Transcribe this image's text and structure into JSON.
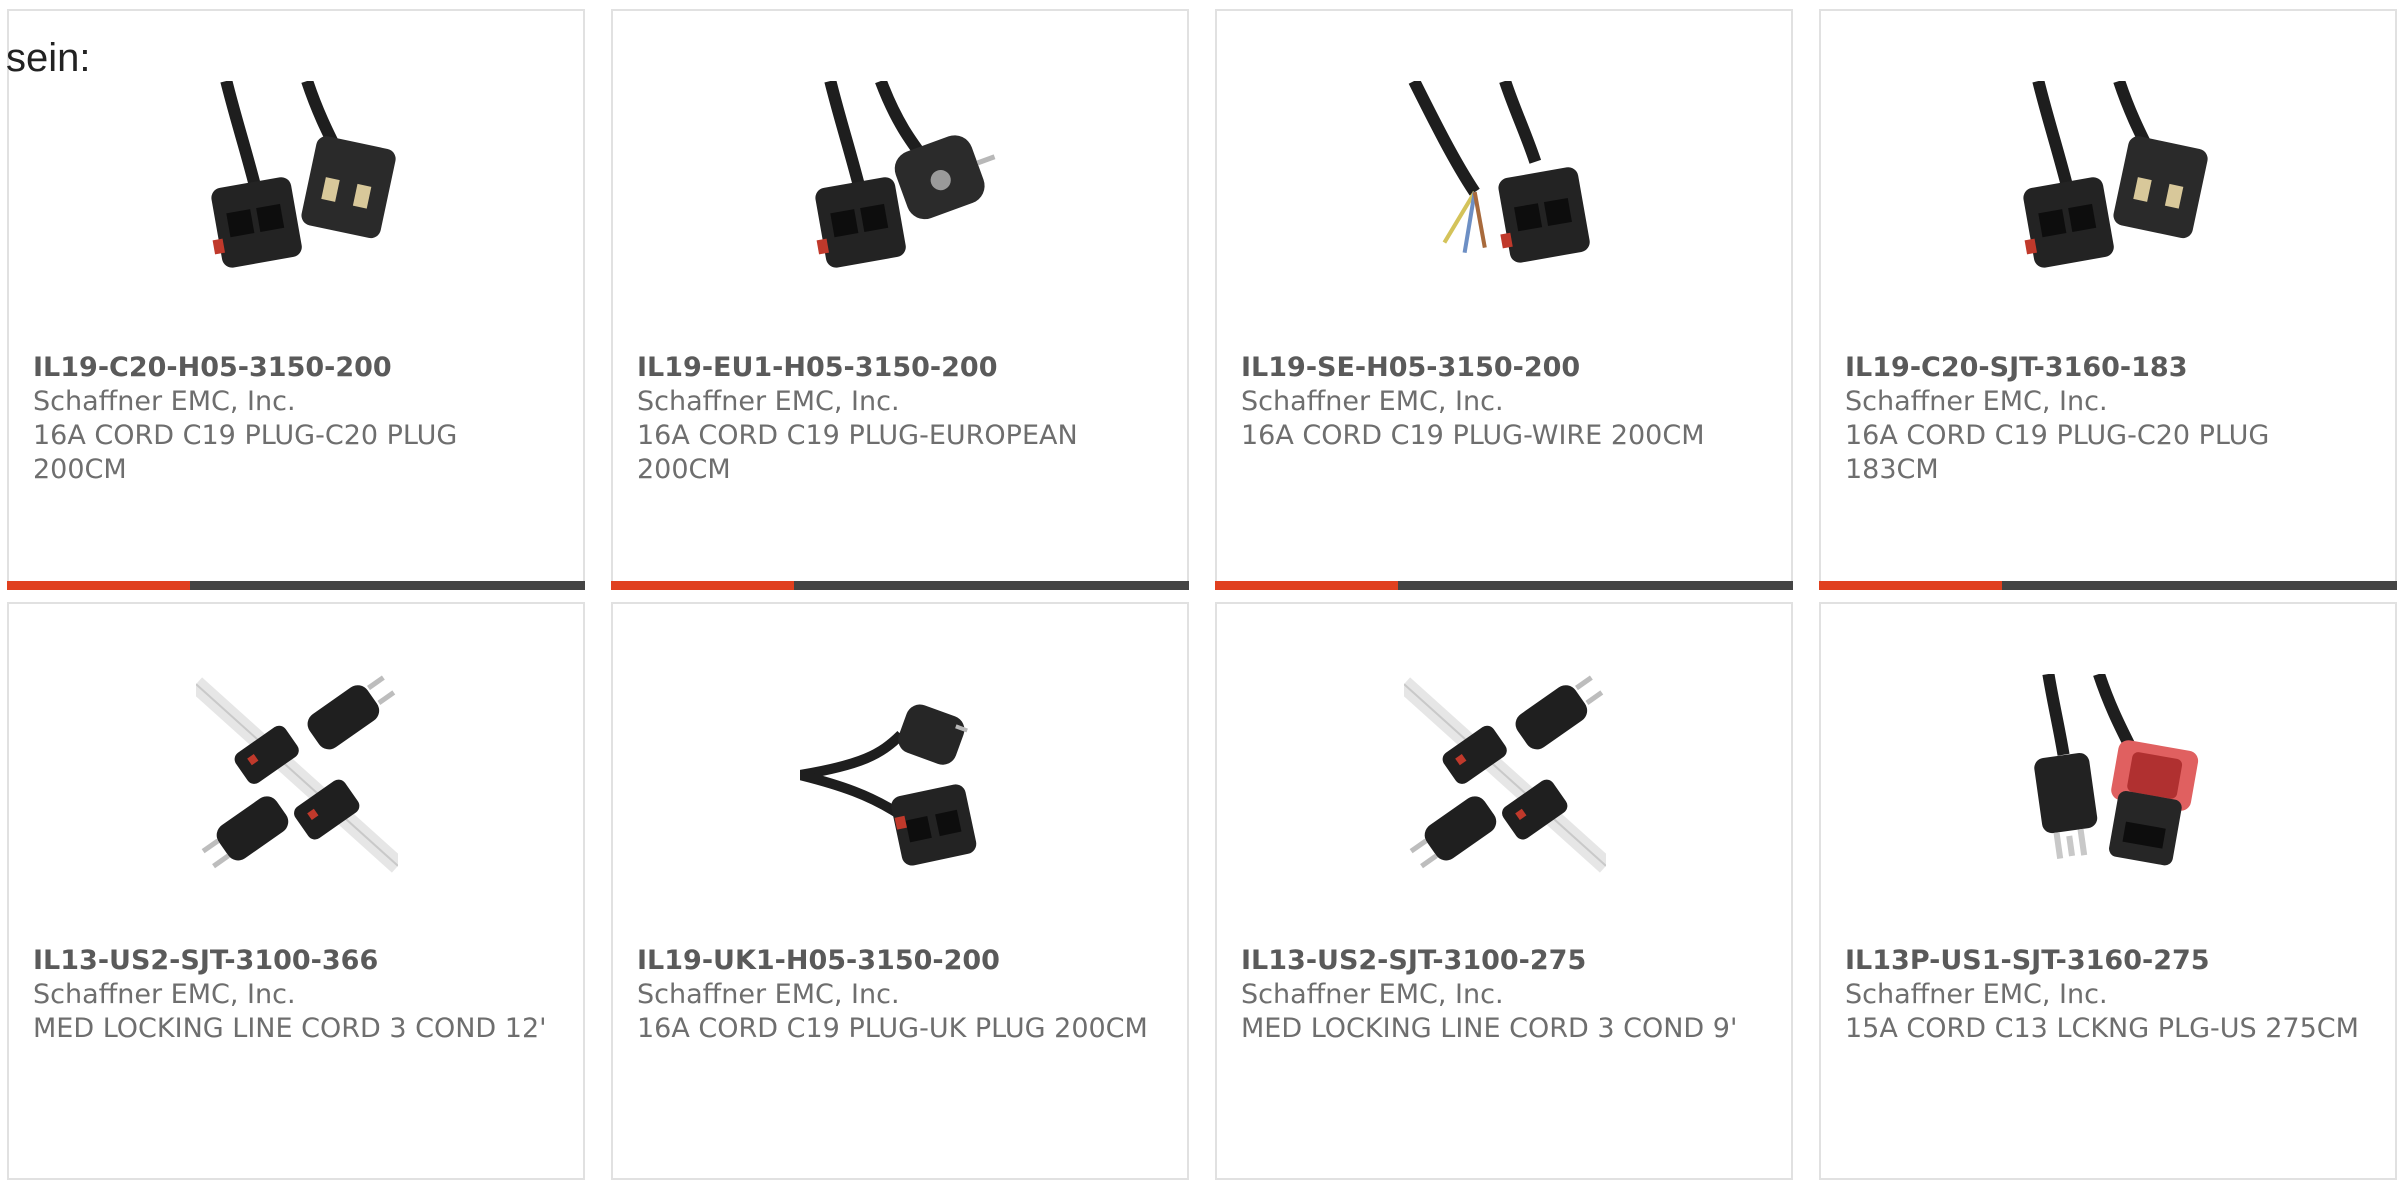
{
  "intro": {
    "text": "sein:"
  },
  "colors": {
    "accent": "#e0401f",
    "bar": "#444444",
    "text": "#6e6e6e",
    "border": "#e1e1e1"
  },
  "products": [
    {
      "part_number": "IL19-C20-H05-3150-200",
      "manufacturer": "Schaffner EMC, Inc.",
      "description": "16A CORD C19 PLUG-C20 PLUG 200CM",
      "image": "cord-c19-c20-image"
    },
    {
      "part_number": "IL19-EU1-H05-3150-200",
      "manufacturer": "Schaffner EMC, Inc.",
      "description": "16A CORD C19 PLUG-EUROPEAN 200CM",
      "image": "cord-c19-european-image"
    },
    {
      "part_number": "IL19-SE-H05-3150-200",
      "manufacturer": "Schaffner EMC, Inc.",
      "description": "16A CORD C19 PLUG-WIRE 200CM",
      "image": "cord-c19-wire-image"
    },
    {
      "part_number": "IL19-C20-SJT-3160-183",
      "manufacturer": "Schaffner EMC, Inc.",
      "description": "16A CORD C19 PLUG-C20 PLUG 183CM",
      "image": "cord-c19-c20-image"
    },
    {
      "part_number": "IL13-US2-SJT-3100-366",
      "manufacturer": "Schaffner EMC, Inc.",
      "description": "MED LOCKING LINE CORD 3 COND 12'",
      "image": "cord-us-locking-image"
    },
    {
      "part_number": "IL19-UK1-H05-3150-200",
      "manufacturer": "Schaffner EMC, Inc.",
      "description": "16A CORD C19 PLUG-UK PLUG 200CM",
      "image": "cord-c19-uk-image"
    },
    {
      "part_number": "IL13-US2-SJT-3100-275",
      "manufacturer": "Schaffner EMC, Inc.",
      "description": "MED LOCKING LINE CORD 3 COND 9'",
      "image": "cord-us-locking-image"
    },
    {
      "part_number": "IL13P-US1-SJT-3160-275",
      "manufacturer": "Schaffner EMC, Inc.",
      "description": "15A CORD C13 LCKNG PLG-US 275CM",
      "image": "cord-c13-us-red-lock-image"
    }
  ]
}
